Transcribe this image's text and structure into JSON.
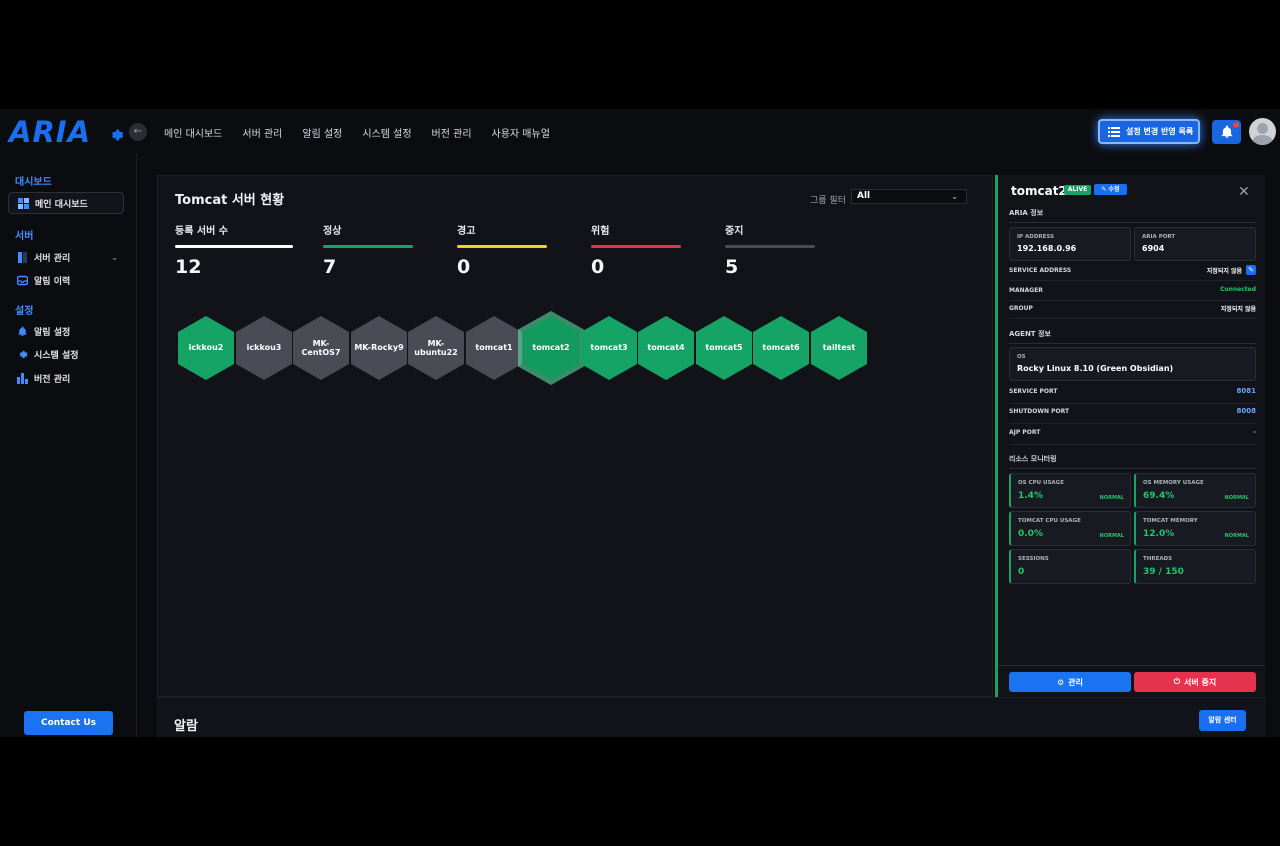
{
  "app": {
    "logo": "ARIA"
  },
  "topnav": [
    "메인 대시보드",
    "서버 관리",
    "알림 설정",
    "시스템 설정",
    "버전 관리",
    "사용자 매뉴얼"
  ],
  "header": {
    "deploy_label": "설정 변경 반영 목록"
  },
  "sidebar": {
    "sections": [
      {
        "title": "대시보드",
        "items": [
          {
            "label": "메인 대시보드",
            "icon": "dashboard-icon",
            "active": true
          }
        ]
      },
      {
        "title": "서버",
        "items": [
          {
            "label": "서버 관리",
            "icon": "server-icon"
          },
          {
            "label": "알림 이력",
            "icon": "inbox-icon"
          }
        ]
      },
      {
        "title": "설정",
        "items": [
          {
            "label": "알림 설정",
            "icon": "bell-icon"
          },
          {
            "label": "시스템 설정",
            "icon": "gear-icon"
          },
          {
            "label": "버전 관리",
            "icon": "bar-chart-icon"
          }
        ]
      }
    ],
    "contact_label": "Contact Us"
  },
  "main": {
    "title": "Tomcat 서버 현황",
    "group_filter_label": "그룹 필터",
    "group_filter_value": "All",
    "stats": [
      {
        "label": "등록 서버 수",
        "value": "12",
        "color": "#ffffff"
      },
      {
        "label": "정상",
        "value": "7",
        "color": "#15a366"
      },
      {
        "label": "경고",
        "value": "0",
        "color": "#f5d02a"
      },
      {
        "label": "위험",
        "value": "0",
        "color": "#e5334f"
      },
      {
        "label": "중지",
        "value": "5",
        "color": "#4a4c55"
      }
    ],
    "servers": [
      {
        "name": "ickkou2",
        "status": "green"
      },
      {
        "name": "ickkou3",
        "status": "gray"
      },
      {
        "name": "MK-CentOS7",
        "status": "gray"
      },
      {
        "name": "MK-Rocky9",
        "status": "gray"
      },
      {
        "name": "MK-ubuntu22",
        "status": "gray"
      },
      {
        "name": "tomcat1",
        "status": "gray"
      },
      {
        "name": "tomcat2",
        "status": "green",
        "selected": true
      },
      {
        "name": "tomcat3",
        "status": "green"
      },
      {
        "name": "tomcat4",
        "status": "green"
      },
      {
        "name": "tomcat5",
        "status": "green"
      },
      {
        "name": "tomcat6",
        "status": "green"
      },
      {
        "name": "tailtest",
        "status": "green"
      }
    ]
  },
  "alarm": {
    "title": "알람",
    "center_label": "알람 센터"
  },
  "detail": {
    "name": "tomcat2",
    "status_badge": "ALIVE",
    "edit_label": "수정",
    "aria_section": "ARIA 정보",
    "ip_label": "IP ADDRESS",
    "ip_value": "192.168.0.96",
    "port_label": "ARIA PORT",
    "port_value": "6904",
    "service_address_label": "SERVICE ADDRESS",
    "service_address_value": "지정되지 않음",
    "manager_label": "MANAGER",
    "manager_value": "Connected",
    "group_label": "GROUP",
    "group_value": "지정되지 않음",
    "agent_section": "AGENT 정보",
    "os_label": "OS",
    "os_value": "Rocky Linux 8.10 (Green Obsidian)",
    "service_port_label": "SERVICE PORT",
    "service_port_value": "8081",
    "shutdown_port_label": "SHUTDOWN PORT",
    "shutdown_port_value": "8008",
    "ajp_port_label": "AJP PORT",
    "ajp_port_value": "-",
    "monitor_section": "리소스 모니터링",
    "monitors": [
      {
        "label": "OS CPU USAGE",
        "value": "1.4%",
        "status": "NORMAL"
      },
      {
        "label": "OS MEMORY USAGE",
        "value": "69.4%",
        "status": "NORMAL"
      },
      {
        "label": "TOMCAT CPU USAGE",
        "value": "0.0%",
        "status": "NORMAL"
      },
      {
        "label": "TOMCAT MEMORY",
        "value": "12.0%",
        "status": "NORMAL"
      },
      {
        "label": "SESSIONS",
        "value": "0",
        "status": ""
      },
      {
        "label": "THREADS",
        "value": "39 / 150",
        "status": ""
      }
    ],
    "manage_label": "관리",
    "stop_label": "서버 중지"
  }
}
